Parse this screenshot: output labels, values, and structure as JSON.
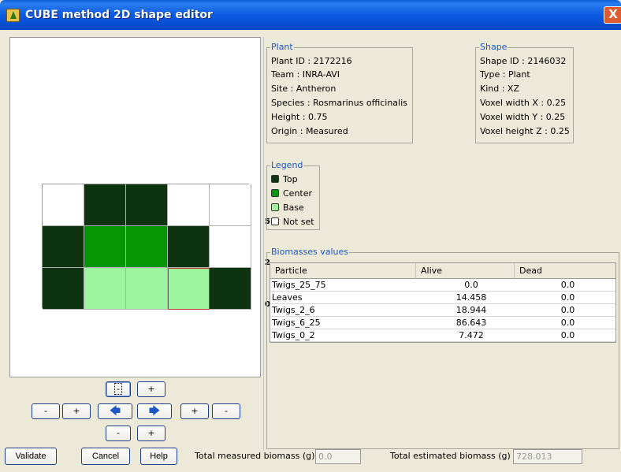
{
  "window": {
    "title": "CUBE method 2D shape editor",
    "close": "X"
  },
  "colors": {
    "top": "#0d3310",
    "center": "#059605",
    "base": "#9cf49c",
    "notset": "#ffffff",
    "titlebar": "#0b5be0",
    "accent": "#1c57c6"
  },
  "grid": {
    "row_labels": [
      "5",
      "2",
      "0"
    ],
    "rows": [
      [
        "notset",
        "top",
        "top",
        "notset",
        "notset"
      ],
      [
        "top",
        "center",
        "center",
        "top",
        "notset"
      ],
      [
        "top",
        "base",
        "base",
        "base",
        "top"
      ]
    ],
    "selected_cell": "row 3, column 4"
  },
  "nav": {
    "zoom_minus": "-",
    "zoom_plus": "+",
    "left_minus": "-",
    "left_plus": "+",
    "left_arrow": "🡄",
    "right_arrow": "🡆",
    "right_plus": "+",
    "right_minus": "-",
    "bottom_minus": "-",
    "bottom_plus": "+"
  },
  "plant": {
    "title": "Plant",
    "lines": [
      "Plant ID : 2172216",
      "Team : INRA-AVI",
      "Site : Antheron",
      "Species : Rosmarinus officinalis",
      "Height : 0.75",
      "Origin : Measured"
    ]
  },
  "shape": {
    "title": "Shape",
    "lines": [
      "Shape ID : 2146032",
      "Type : Plant",
      "Kind : XZ",
      "Voxel width X : 0.25",
      "Voxel width Y : 0.25",
      "Voxel height Z : 0.25"
    ]
  },
  "legend": {
    "title": "Legend",
    "items": [
      {
        "label": "Top",
        "color": "#0d3310"
      },
      {
        "label": "Center",
        "color": "#059605"
      },
      {
        "label": "Base",
        "color": "#9cf49c"
      },
      {
        "label": "Not set",
        "color": "#ffffff"
      }
    ]
  },
  "biomass": {
    "title": "Biomasses values",
    "columns": [
      "Particle",
      "Alive",
      "Dead"
    ],
    "rows": [
      [
        "Twigs_25_75",
        "0.0",
        "0.0"
      ],
      [
        "Leaves",
        "14.458",
        "0.0"
      ],
      [
        "Twigs_2_6",
        "18.944",
        "0.0"
      ],
      [
        "Twigs_6_25",
        "86.643",
        "0.0"
      ],
      [
        "Twigs_0_2",
        "7.472",
        "0.0"
      ]
    ]
  },
  "footer": {
    "validate": "Validate",
    "cancel": "Cancel",
    "help": "Help",
    "measured_label": "Total measured biomass (g)",
    "measured_value": "0.0",
    "estimated_label": "Total estimated biomass (g)",
    "estimated_value": "728.013"
  }
}
